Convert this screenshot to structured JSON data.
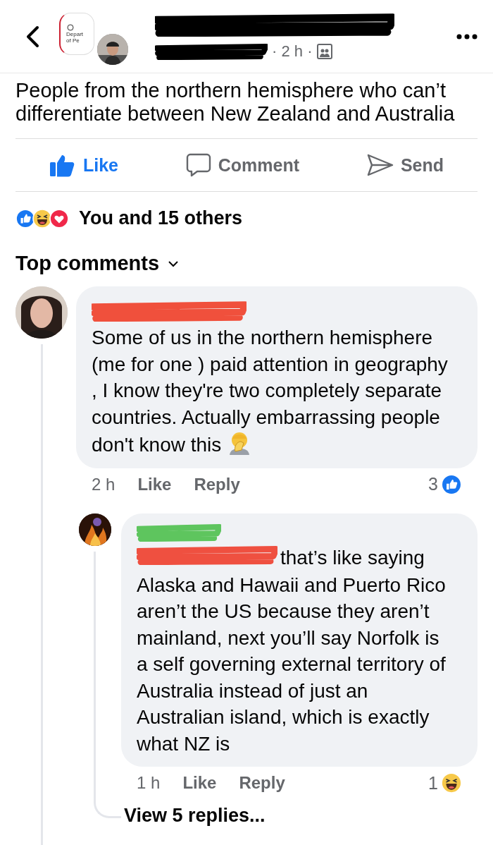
{
  "header": {
    "logo_text": [
      "Depart",
      "of Pe"
    ],
    "meta": "· 2 h ·"
  },
  "post": {
    "text": "People from the northern hemisphere who can’t differentiate between New Zealand and Australia"
  },
  "actions": [
    {
      "kind": "like",
      "label": "Like",
      "selected": true
    },
    {
      "kind": "comment",
      "label": "Comment",
      "selected": false
    },
    {
      "kind": "send",
      "label": "Send",
      "selected": false
    }
  ],
  "reactions": {
    "icons": [
      {
        "kind": "like"
      },
      {
        "kind": "haha"
      },
      {
        "kind": "love"
      }
    ],
    "summary": "You and 15 others"
  },
  "comments_header": {
    "label": "Top comments"
  },
  "comment": {
    "text": "Some of us in the northern hemisphere (me for one ) paid attention in geography , I know they're two completely separate countries. Actually embarrassing people don't know this",
    "trailing_emoji": {
      "kind": "facepalm"
    },
    "time": "2 h",
    "like": "Like",
    "reply": "Reply",
    "reaction_count": "3",
    "reaction_icon": {
      "kind": "like"
    },
    "reply_item": {
      "text": "that’s like saying Alaska and Hawaii and Puerto Rico aren’t the US because they aren’t mainland, next you’ll say Norfolk is a self governing external territory of Australia instead of just an Australian island, which is exactly what NZ is",
      "time": "1 h",
      "like": "Like",
      "reply": "Reply",
      "reaction_count": "1",
      "reaction_icon": {
        "kind": "haha"
      }
    },
    "view_replies": "View 5 replies..."
  }
}
